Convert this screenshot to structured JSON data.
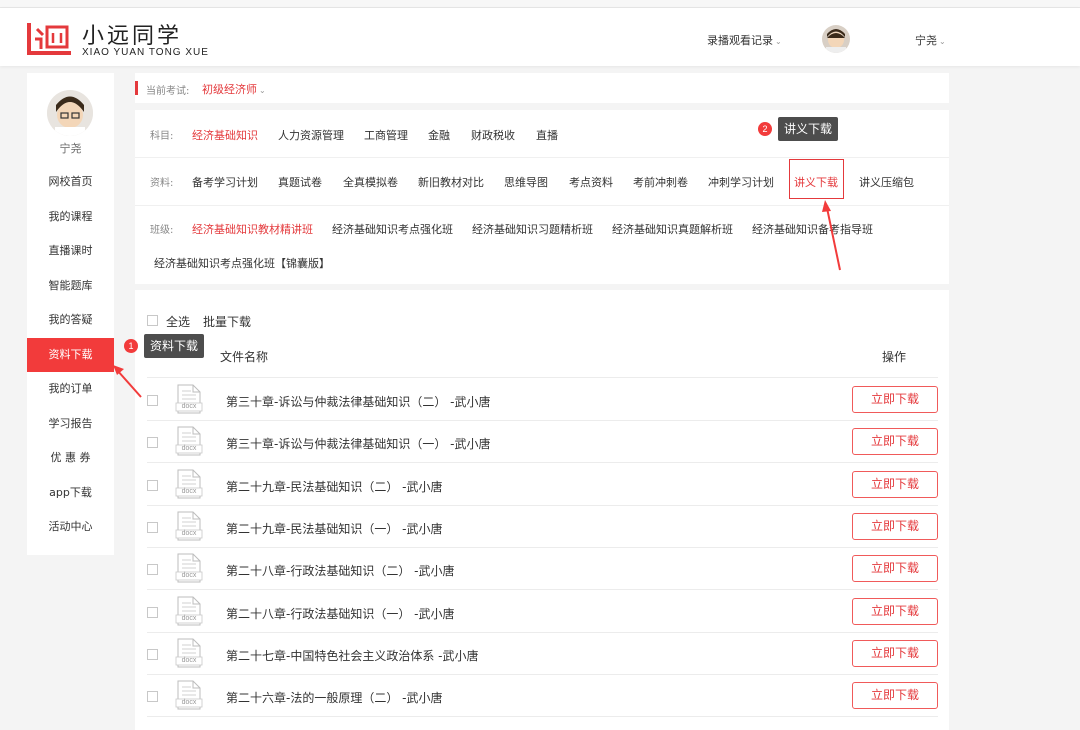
{
  "header": {
    "brand_cn": "小远同学",
    "brand_en": "XIAO YUAN TONG XUE",
    "recording": "录播观看记录",
    "username": "宁尧"
  },
  "sidebar": {
    "username": "宁尧",
    "items": [
      {
        "label": "网校首页"
      },
      {
        "label": "我的课程"
      },
      {
        "label": "直播课时"
      },
      {
        "label": "智能题库"
      },
      {
        "label": "我的答疑"
      },
      {
        "label": "资料下载"
      },
      {
        "label": "我的订单"
      },
      {
        "label": "学习报告"
      },
      {
        "label": "优 惠 券"
      },
      {
        "label": "app下载"
      },
      {
        "label": "活动中心"
      }
    ]
  },
  "exam": {
    "label": "当前考试:",
    "value": "初级经济师"
  },
  "filters": {
    "subject_label": "科目:",
    "subjects": [
      "经济基础知识",
      "人力资源管理",
      "工商管理",
      "金融",
      "财政税收",
      "直播"
    ],
    "material_label": "资料:",
    "materials": [
      "备考学习计划",
      "真题试卷",
      "全真模拟卷",
      "新旧教材对比",
      "思维导图",
      "考点资料",
      "考前冲刺卷",
      "冲刺学习计划",
      "讲义下载",
      "讲义压缩包"
    ],
    "class_label": "班级:",
    "classes": [
      "经济基础知识教材精讲班",
      "经济基础知识考点强化班",
      "经济基础知识习题精析班",
      "经济基础知识真题解析班",
      "经济基础知识备考指导班",
      "经济基础知识考点强化班【锦囊版】"
    ]
  },
  "list": {
    "select_all": "全选",
    "batch": "批量下载",
    "col_name": "文件名称",
    "col_op": "操作",
    "download_label": "立即下载",
    "file_ext": "docx",
    "files": [
      "第三十章-诉讼与仲裁法律基础知识（二） -武小唐",
      "第三十章-诉讼与仲裁法律基础知识（一） -武小唐",
      "第二十九章-民法基础知识（二） -武小唐",
      "第二十九章-民法基础知识（一） -武小唐",
      "第二十八章-行政法基础知识（二） -武小唐",
      "第二十八章-行政法基础知识（一） -武小唐",
      "第二十七章-中国特色社会主义政治体系 -武小唐",
      "第二十六章-法的一般原理（二） -武小唐"
    ]
  },
  "annotations": {
    "tip1": {
      "num": "1",
      "text": "资料下载"
    },
    "tip2": {
      "num": "2",
      "text": "讲义下载"
    }
  },
  "colors": {
    "accent": "#e4393c",
    "active_nav": "#f23b3b",
    "tooltip": "#4d4d4d"
  }
}
